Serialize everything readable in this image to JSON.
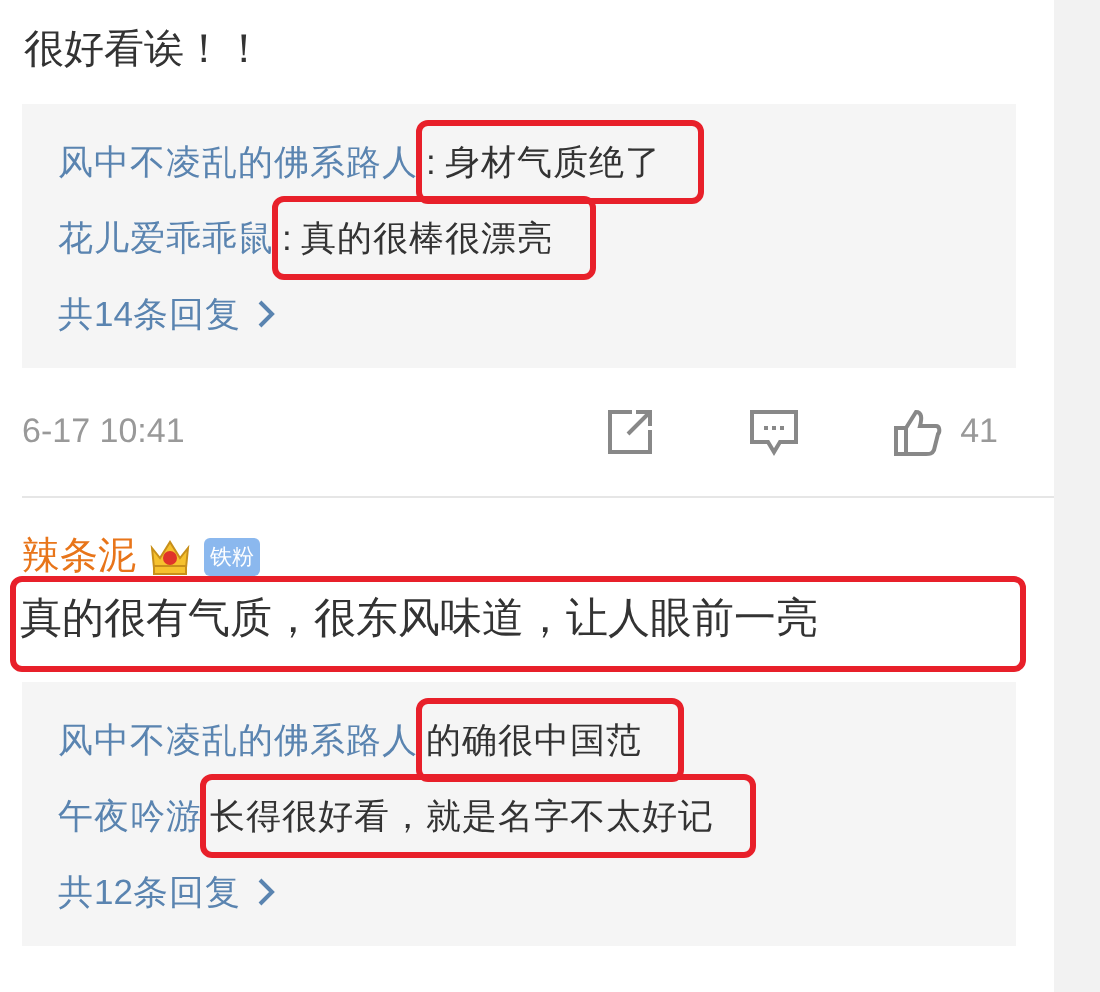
{
  "comments": [
    {
      "text": "很好看诶！！",
      "highlighted": false,
      "replies": [
        {
          "user": "风中不凌乱的佛系路人",
          "text": ": 身材气质绝了",
          "highlighted": true
        },
        {
          "user": "花儿爱乖乖鼠",
          "text": ": 真的很棒很漂亮",
          "highlighted": true
        }
      ],
      "more": "共14条回复",
      "time": "6-17 10:41",
      "likes": "41"
    },
    {
      "user": "辣条泥",
      "badge": "铁粉",
      "text": "真的很有气质，很东风味道，让人眼前一亮",
      "highlighted": true,
      "replies": [
        {
          "user": "风中不凌乱的佛系路人",
          "text": "的确很中国范",
          "highlighted": true
        },
        {
          "user": "午夜吟游",
          "text": "长得很好看，就是名字不太好记",
          "highlighted": true
        }
      ],
      "more": "共12条回复"
    }
  ]
}
